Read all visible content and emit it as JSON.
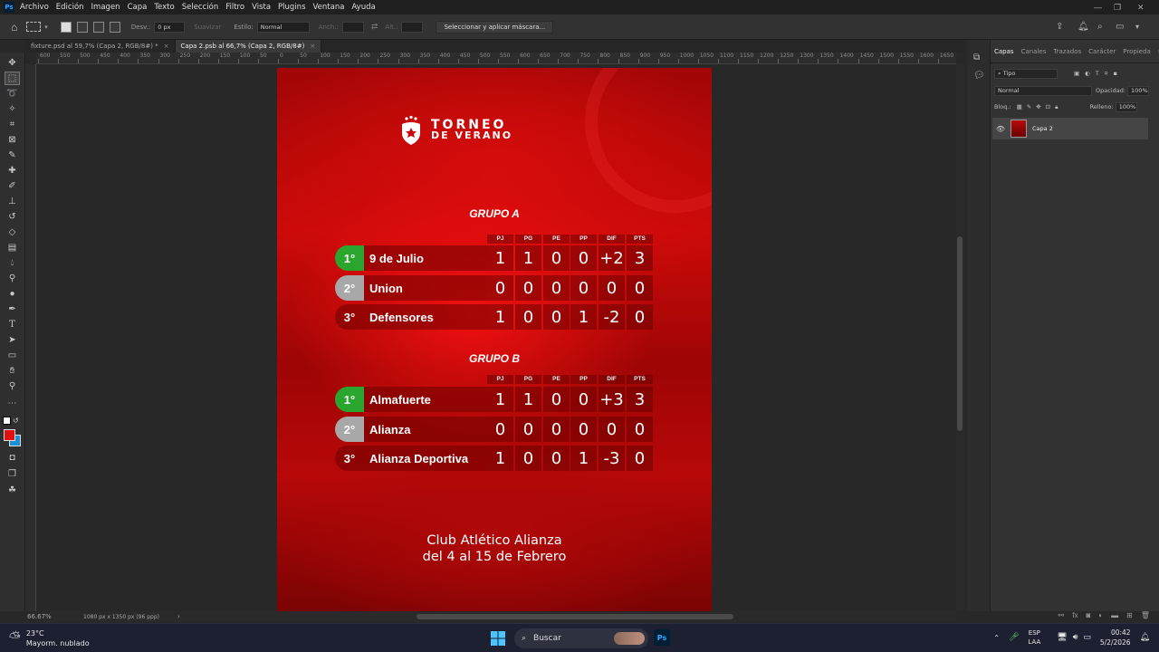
{
  "app": {
    "logo": "Ps",
    "menu": [
      "Archivo",
      "Edición",
      "Imagen",
      "Capa",
      "Texto",
      "Selección",
      "Filtro",
      "Vista",
      "Plugins",
      "Ventana",
      "Ayuda"
    ]
  },
  "options": {
    "desv_label": "Desv.:",
    "desv_value": "0 px",
    "suavizar": "Suavizar",
    "estilo_label": "Estilo:",
    "estilo_value": "Normal",
    "anch_label": "Anch.:",
    "alt_label": "Alt.:",
    "mask_button": "Seleccionar y aplicar máscara..."
  },
  "tabs": [
    {
      "label": "fixture.psd al 59,7% (Capa 2, RGB/8#) *"
    },
    {
      "label": "Capa 2.psb al 66,7% (Capa 2, RGB/8#)"
    }
  ],
  "ruler": {
    "h_ticks": [
      "600",
      "550",
      "500",
      "450",
      "400",
      "350",
      "300",
      "250",
      "200",
      "150",
      "100",
      "50",
      "0",
      "50",
      "100",
      "150",
      "200",
      "250",
      "300",
      "350",
      "400",
      "450",
      "500",
      "550",
      "600",
      "650",
      "700",
      "750",
      "800",
      "850",
      "900",
      "950",
      "1000",
      "1050",
      "1100",
      "1150",
      "1200",
      "1250",
      "1300",
      "1350",
      "1400",
      "1450",
      "1500",
      "1550",
      "1600",
      "1650"
    ]
  },
  "status": {
    "zoom": "66.67%",
    "size": "1080 px x 1350 px (96 ppp)"
  },
  "poster": {
    "logo_line1": "TORNEO",
    "logo_line2": "DE VERANO",
    "col_headers": [
      "PJ",
      "PG",
      "PE",
      "PP",
      "DIF",
      "PTS"
    ],
    "group_a": {
      "title": "GRUPO A",
      "rows": [
        {
          "pos": "1°",
          "team": "9 de Julio",
          "stats": [
            "1",
            "1",
            "0",
            "0",
            "+2",
            "3"
          ],
          "color": "#2aa52e"
        },
        {
          "pos": "2°",
          "team": "Union",
          "stats": [
            "0",
            "0",
            "0",
            "0",
            "0",
            "0"
          ],
          "color": "#a8a8a8"
        },
        {
          "pos": "3°",
          "team": "Defensores",
          "stats": [
            "1",
            "0",
            "0",
            "1",
            "-2",
            "0"
          ],
          "color": "transparent"
        }
      ]
    },
    "group_b": {
      "title": "GRUPO B",
      "rows": [
        {
          "pos": "1°",
          "team": "Almafuerte",
          "stats": [
            "1",
            "1",
            "0",
            "0",
            "+3",
            "3"
          ],
          "color": "#2aa52e"
        },
        {
          "pos": "2°",
          "team": "Alianza",
          "stats": [
            "0",
            "0",
            "0",
            "0",
            "0",
            "0"
          ],
          "color": "#a8a8a8"
        },
        {
          "pos": "3°",
          "team": "Alianza Deportiva",
          "stats": [
            "1",
            "0",
            "0",
            "1",
            "-3",
            "0"
          ],
          "color": "transparent"
        }
      ]
    },
    "footer_line1": "Club Atlético Alianza",
    "footer_line2": "del 4 al 15 de Febrero"
  },
  "panel": {
    "tabs": [
      "Capas",
      "Canales",
      "Trazados",
      "Carácter",
      "Propieda"
    ],
    "kind_filter": "Tipo",
    "blend_mode": "Normal",
    "opacity_label": "Opacidad:",
    "opacity_value": "100%",
    "lock_label": "Bloq.:",
    "fill_label": "Relleno:",
    "fill_value": "100%",
    "layer_name": "Capa 2"
  },
  "taskbar": {
    "temp": "23°C",
    "weather": "Mayorm. nublado",
    "search": "Buscar",
    "lang1": "ESP",
    "lang2": "LAA",
    "time": "00:42",
    "date": "5/2/2026"
  }
}
